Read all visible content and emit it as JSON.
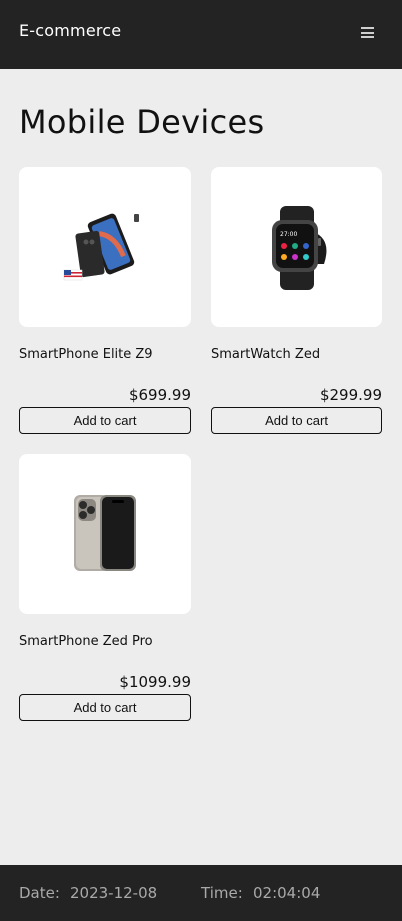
{
  "header": {
    "brand": "E-commerce",
    "menu_icon": "hamburger-menu-icon"
  },
  "main": {
    "title": "Mobile Devices",
    "products": [
      {
        "name": "SmartPhone Elite Z9",
        "price": "$699.99",
        "button": "Add to cart",
        "image": "smartphone-image"
      },
      {
        "name": "SmartWatch Zed",
        "price": "$299.99",
        "button": "Add to cart",
        "image": "smartwatch-image"
      },
      {
        "name": "SmartPhone Zed Pro",
        "price": "$1099.99",
        "button": "Add to cart",
        "image": "smartphone-pro-image"
      }
    ]
  },
  "footer": {
    "date_label": "Date:",
    "date_value": "2023-12-08",
    "time_label": "Time:",
    "time_value": "02:04:04"
  },
  "colors": {
    "header_bg": "#232323",
    "page_bg": "#ededed",
    "card_bg": "#ffffff"
  }
}
